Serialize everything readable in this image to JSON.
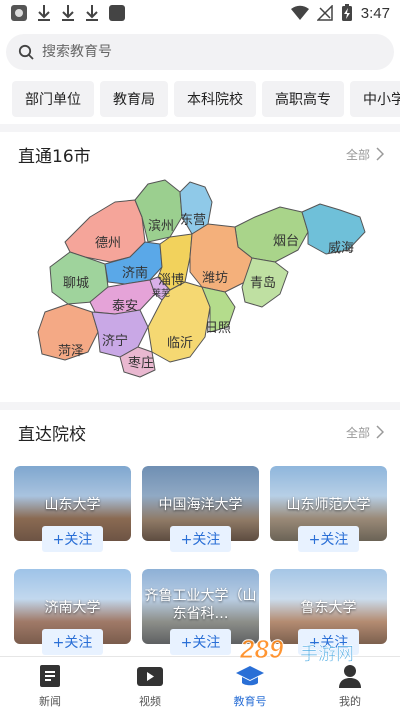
{
  "status_bar": {
    "time": "3:47"
  },
  "search": {
    "placeholder": "搜索教育号"
  },
  "categories": [
    "部门单位",
    "教育局",
    "本科院校",
    "高职高专",
    "中小学"
  ],
  "section_cities": {
    "title": "直通16市",
    "more": "全部"
  },
  "cities": [
    "德州",
    "滨州",
    "东营",
    "烟台",
    "威海",
    "聊城",
    "济南",
    "淄博",
    "潍坊",
    "青岛",
    "泰安",
    "莱芜",
    "菏泽",
    "济宁",
    "临沂",
    "日照",
    "枣庄"
  ],
  "section_schools": {
    "title": "直达院校",
    "more": "全部"
  },
  "schools": [
    {
      "name": "山东大学",
      "follow": "+关注"
    },
    {
      "name": "中国海洋大学",
      "follow": "+关注"
    },
    {
      "name": "山东师范大学",
      "follow": "+关注"
    },
    {
      "name": "济南大学",
      "follow": "+关注"
    },
    {
      "name": "齐鲁工业大学（山东省科…",
      "follow": "+关注"
    },
    {
      "name": "鲁东大学",
      "follow": "+关注"
    }
  ],
  "tabs": [
    {
      "label": "新闻",
      "icon": "news-icon"
    },
    {
      "label": "视频",
      "icon": "video-icon"
    },
    {
      "label": "教育号",
      "icon": "graduation-cap-icon"
    },
    {
      "label": "我的",
      "icon": "user-icon"
    }
  ],
  "watermark": "289手游网",
  "colors": {
    "accent": "#2a6fd6",
    "follow_bg": "#e8f2ff"
  }
}
